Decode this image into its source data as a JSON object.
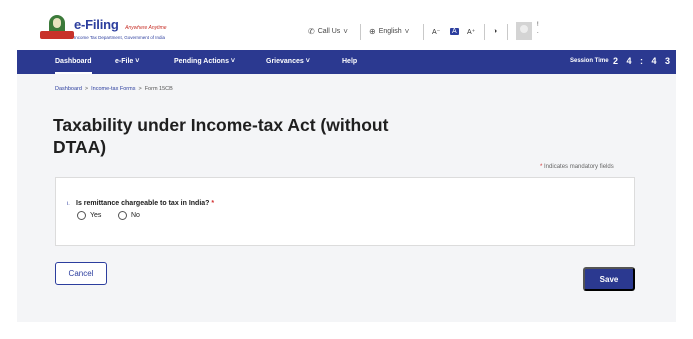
{
  "header": {
    "brand_main": "e-Filing",
    "brand_tag": "Anywhere Anytime",
    "brand_sub": "Income Tax Department, Government of India",
    "call_us": "Call Us",
    "language": "English",
    "font_small": "A⁻",
    "font_normal": "A",
    "font_large": "A⁺",
    "contrast_icon": "contrast-icon",
    "avatar_text_1": "!",
    "avatar_text_2": "."
  },
  "nav": {
    "items": [
      {
        "label": "Dashboard",
        "active": true
      },
      {
        "label": "e-File ˅"
      },
      {
        "label": "Pending Actions ˅"
      },
      {
        "label": "Grievances ˅"
      },
      {
        "label": "Help"
      }
    ],
    "session_label": "Session Time",
    "session_time": "2 4 : 4 3"
  },
  "breadcrumb": {
    "items": [
      "Dashboard",
      "Income-tax Forms",
      "Form 15CB"
    ]
  },
  "page": {
    "title": "Taxability under Income-tax Act (without DTAA)",
    "mandatory_note": "Indicates mandatory fields",
    "mandatory_star": "*"
  },
  "question": {
    "number": "i.",
    "text": "Is remittance chargeable to tax in India?",
    "required_star": "*",
    "options": [
      "Yes",
      "No"
    ]
  },
  "actions": {
    "cancel_label": "Cancel",
    "save_label": "Save"
  },
  "colors": {
    "nav_bg": "#2b3990",
    "brand_blue": "#2c3e9e",
    "required_red": "#d32f2f"
  }
}
